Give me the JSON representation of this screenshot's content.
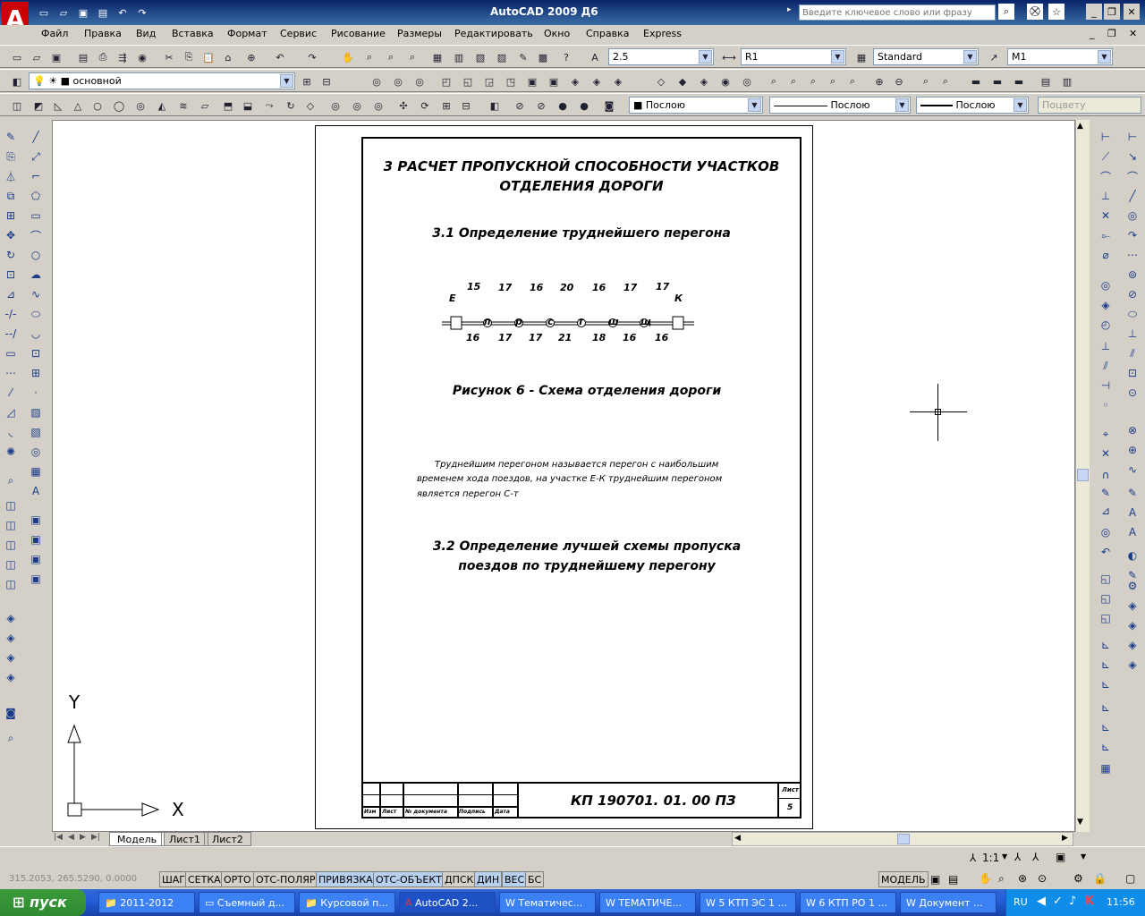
{
  "title": {
    "app": "AutoCAD 2009  Д6",
    "search_placeholder": "Введите ключевое слово или фразу"
  },
  "menu": [
    "Файл",
    "Правка",
    "Вид",
    "Вставка",
    "Формат",
    "Сервис",
    "Рисование",
    "Размеры",
    "Редактировать",
    "Окно",
    "Справка",
    "Express"
  ],
  "toolbar1": {
    "text_height": "2.5",
    "dim_style": "R1",
    "table_style": "Standard",
    "mleader_style": "M1"
  },
  "toolbar2": {
    "layer": "основной"
  },
  "toolbar3": {
    "color": "Послою",
    "linetype": "Послою",
    "lineweight": "Послою",
    "plotstyle": "Поцвету"
  },
  "drawing": {
    "heading1_line1": "3  РАСЧЕТ ПРОПУСКНОЙ СПОСОБНОСТИ УЧАСТКОВ",
    "heading1_line2": "ОТДЕЛЕНИЯ ДОРОГИ",
    "heading2": "3.1  Определение труднейшего перегона",
    "top_numbers": [
      "15",
      "17",
      "16",
      "20",
      "16",
      "17",
      "17"
    ],
    "bottom_numbers": [
      "16",
      "17",
      "17",
      "21",
      "18",
      "16",
      "16"
    ],
    "stations": [
      "п",
      "р",
      "с",
      "т",
      "ш",
      "щ"
    ],
    "end_left": "Е",
    "end_right": "К",
    "figure_caption": "Рисунок  6  -  Схема отделения дороги",
    "para_line1": "Труднейшим перегоном называется перегон с наибольшим",
    "para_line2": "временем хода поездов, на участке Е-К труднейшим перегоном",
    "para_line3": "является перегон С-т",
    "heading3_line1": "3.2  Определение лучшей схемы пропуска",
    "heading3_line2": "поездов по труднейшему перегону",
    "stamp_code": "КП  190701. 01. 00  ПЗ",
    "stamp_sheet_label": "Лист",
    "stamp_sheet_num": "5",
    "stamp_cols": [
      "Изм",
      "Лист",
      "№ документа",
      "Подпись",
      "Дата"
    ]
  },
  "ucs": {
    "x": "X",
    "y": "Y"
  },
  "tabs": [
    "Модель",
    "Лист1",
    "Лист2"
  ],
  "scale": "1:1",
  "status": {
    "coords": "315.2053, 265.5290, 0.0000",
    "buttons": [
      "ШАГ",
      "СЕТКА",
      "ОРТО",
      "ОТС-ПОЛЯР",
      "ПРИВЯЗКА",
      "ОТС-ОБЪЕКТ",
      "ДПСК",
      "ДИН",
      "ВЕС",
      "БС"
    ],
    "model": "МОДЕЛЬ"
  },
  "taskbar": {
    "start": "пуск",
    "tasks": [
      "2011-2012",
      "Съемный д...",
      "Курсовой п...",
      "AutoCAD 2...",
      "Тематичес...",
      "ТЕМАТИЧЕ...",
      "5 КТП ЭС 1 ...",
      "6 КТП РО 1 ...",
      "Документ ..."
    ],
    "lang": "RU",
    "time": "11:56"
  }
}
